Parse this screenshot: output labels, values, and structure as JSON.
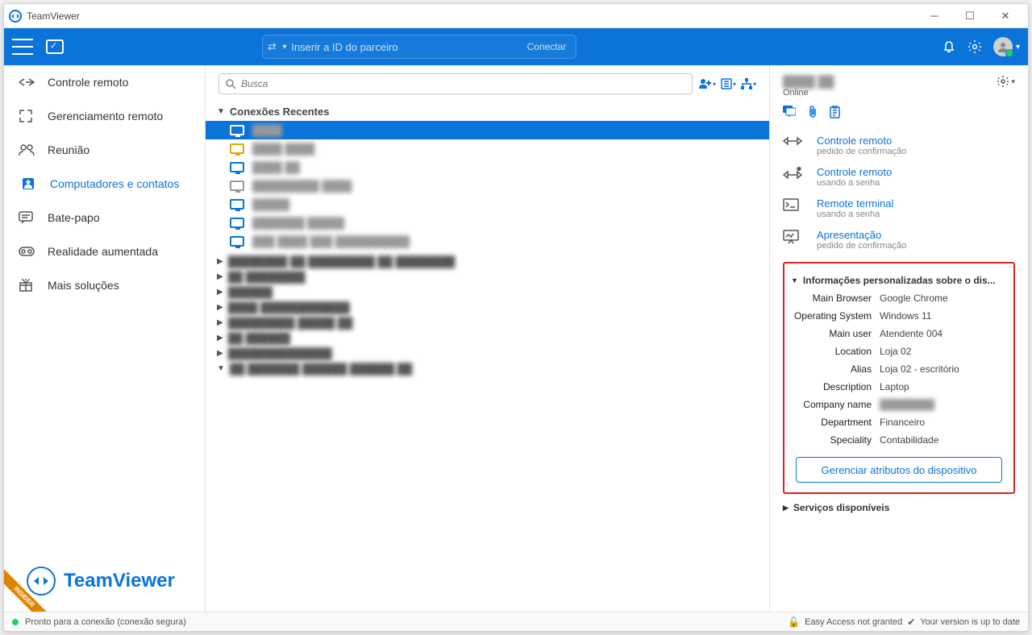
{
  "window": {
    "title": "TeamViewer"
  },
  "ribbon": {
    "partner_placeholder": "Inserir a ID do parceiro",
    "connect_label": "Conectar"
  },
  "sidebar": {
    "items": [
      {
        "label": "Controle remoto"
      },
      {
        "label": "Gerenciamento remoto"
      },
      {
        "label": "Reunião"
      },
      {
        "label": "Computadores e contatos"
      },
      {
        "label": "Bate-papo"
      },
      {
        "label": "Realidade aumentada"
      },
      {
        "label": "Mais soluções"
      }
    ],
    "brand": "TeamViewer",
    "insider": "INSIDER"
  },
  "center": {
    "search_placeholder": "Busca",
    "recent_label": "Conexões Recentes"
  },
  "details": {
    "status": "Online",
    "actions": [
      {
        "title": "Controle remoto",
        "sub": "pedido de confirmação"
      },
      {
        "title": "Controle remoto",
        "sub": "usando a senha"
      },
      {
        "title": "Remote terminal",
        "sub": "usando a senha"
      },
      {
        "title": "Apresentação",
        "sub": "pedido de confirmação"
      }
    ],
    "custom_header": "Informações personalizadas sobre o dis...",
    "fields": [
      {
        "k": "Main Browser",
        "v": "Google Chrome"
      },
      {
        "k": "Operating System",
        "v": "Windows 11"
      },
      {
        "k": "Main user",
        "v": "Atendente 004"
      },
      {
        "k": "Location",
        "v": "Loja 02"
      },
      {
        "k": "Alias",
        "v": "Loja 02 - escritório"
      },
      {
        "k": "Description",
        "v": "Laptop"
      },
      {
        "k": "Company name",
        "v": "████████"
      },
      {
        "k": "Department",
        "v": "Financeiro"
      },
      {
        "k": "Speciality",
        "v": "Contabilidade"
      }
    ],
    "manage_label": "Gerenciar atributos do dispositivo",
    "available_header": "Serviços disponíveis"
  },
  "statusbar": {
    "ready": "Pronto para a conexão (conexão segura)",
    "easy": "Easy Access not granted",
    "version": "Your version is up to date"
  }
}
